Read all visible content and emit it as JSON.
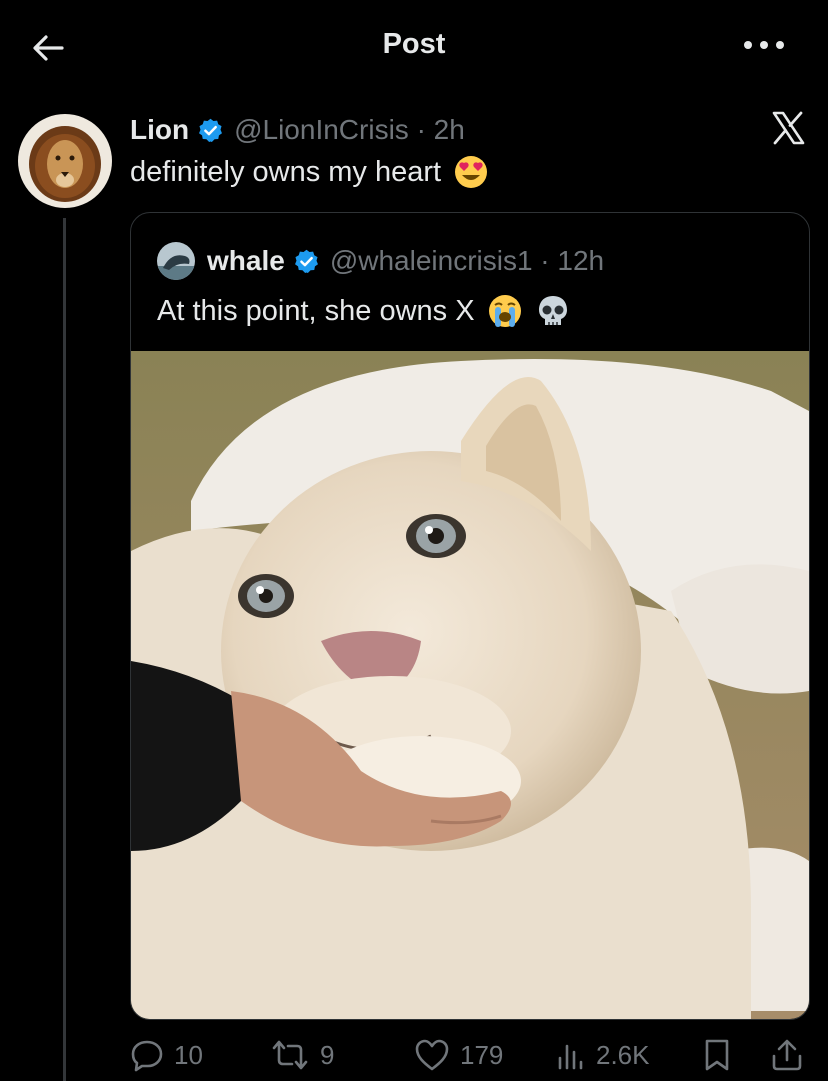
{
  "header": {
    "title": "Post"
  },
  "post": {
    "author_name": "Lion",
    "handle_time": "@LionInCrisis · 2h",
    "text": "definitely owns my heart"
  },
  "quote": {
    "author_name": "whale",
    "handle_time": "@whaleincrisis1 · 12h",
    "text": "At this point, she owns X"
  },
  "actions": {
    "replies": "10",
    "reposts": "9",
    "likes": "179",
    "views": "2.6K"
  },
  "colors": {
    "background": "#000000",
    "text": "#e7e9ea",
    "muted": "#71767b",
    "verified": "#1d9bf0",
    "border": "#2f3336"
  },
  "icons": [
    "back-arrow-icon",
    "more-icon",
    "verified-icon",
    "x-logo-icon",
    "reply-icon",
    "repost-icon",
    "like-icon",
    "views-icon",
    "bookmark-icon",
    "share-icon"
  ]
}
